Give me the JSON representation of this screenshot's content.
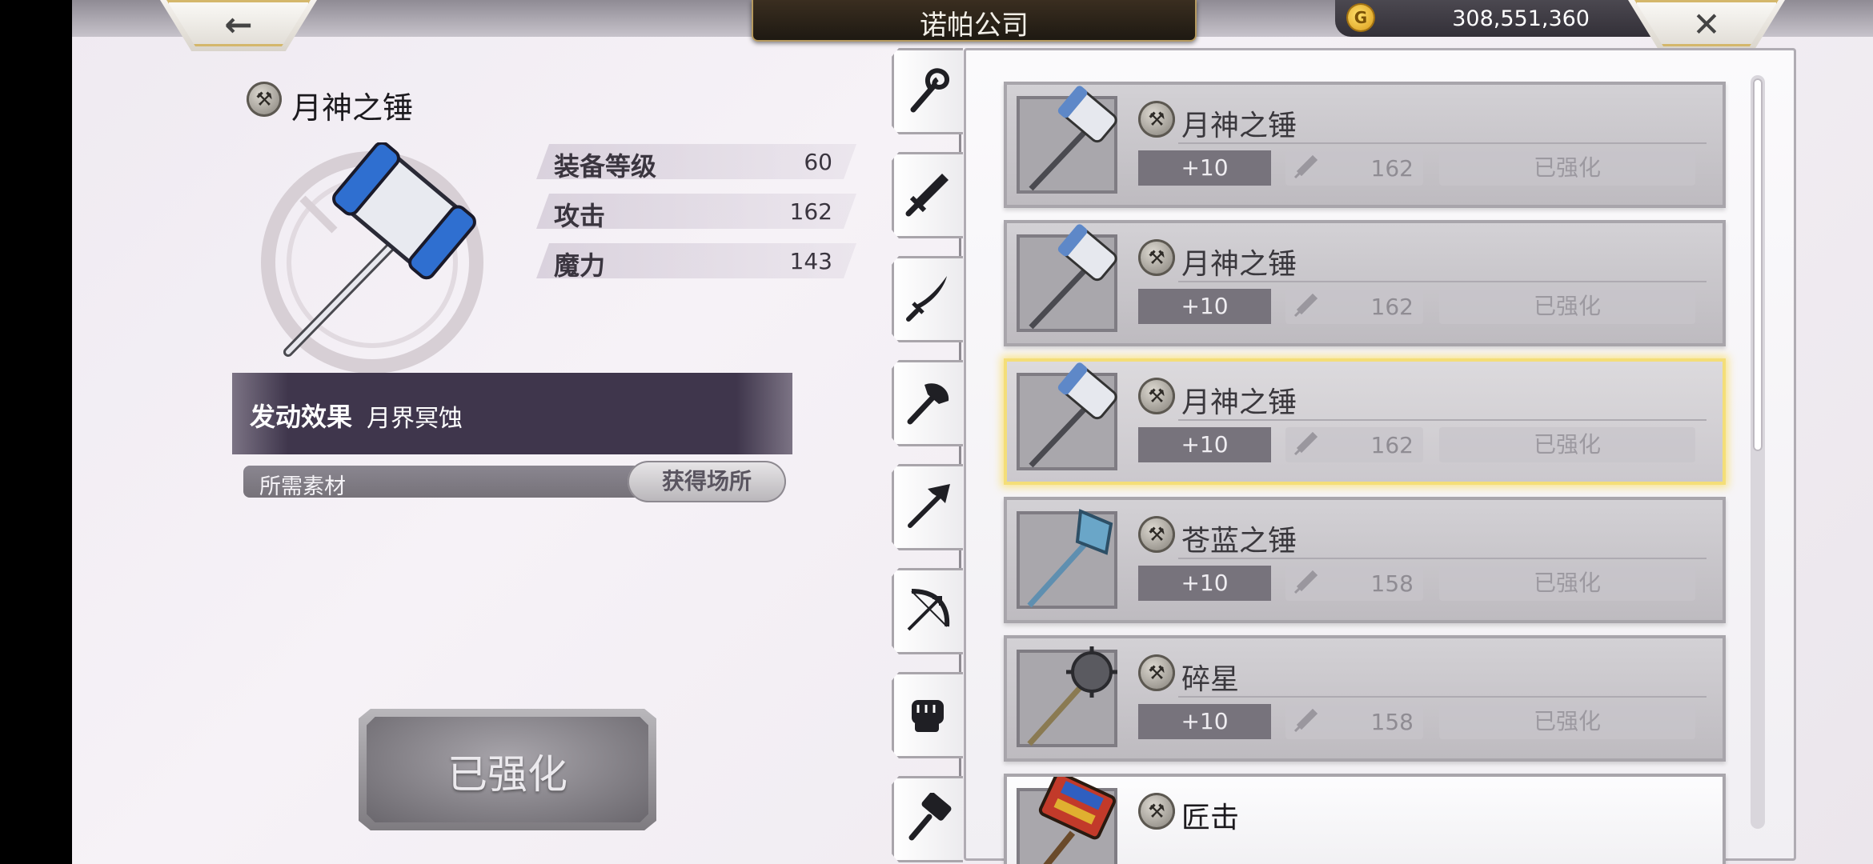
{
  "header": {
    "back_glyph": "←",
    "close_glyph": "✕",
    "shop_title": "诺帕公司",
    "gold": "308,551,360"
  },
  "detail": {
    "name": "月神之锤",
    "stats": [
      {
        "label": "装备等级",
        "value": "60"
      },
      {
        "label": "攻击",
        "value": "162"
      },
      {
        "label": "魔力",
        "value": "143"
      }
    ],
    "effect_label": "发动效果",
    "effect_value": "月界冥蚀",
    "materials_label": "所需素材",
    "source_button": "获得场所",
    "action_button": "已强化"
  },
  "categories": [
    "staff-icon",
    "sword-icon",
    "katana-icon",
    "axe-icon",
    "spear-icon",
    "bow-icon",
    "fist-icon",
    "hammer-icon"
  ],
  "items": [
    {
      "name": "月神之锤",
      "level": "+10",
      "attack": "162",
      "status": "已强化"
    },
    {
      "name": "月神之锤",
      "level": "+10",
      "attack": "162",
      "status": "已强化"
    },
    {
      "name": "月神之锤",
      "level": "+10",
      "attack": "162",
      "status": "已强化"
    },
    {
      "name": "苍蓝之锤",
      "level": "+10",
      "attack": "158",
      "status": "已强化"
    },
    {
      "name": "碎星",
      "level": "+10",
      "attack": "158",
      "status": "已强化"
    },
    {
      "name": "匠击"
    }
  ],
  "colors": {
    "accent_gold": "#f4de78",
    "panel_dark": "#3f364c",
    "hammer_blue": "#2f6fd0"
  }
}
